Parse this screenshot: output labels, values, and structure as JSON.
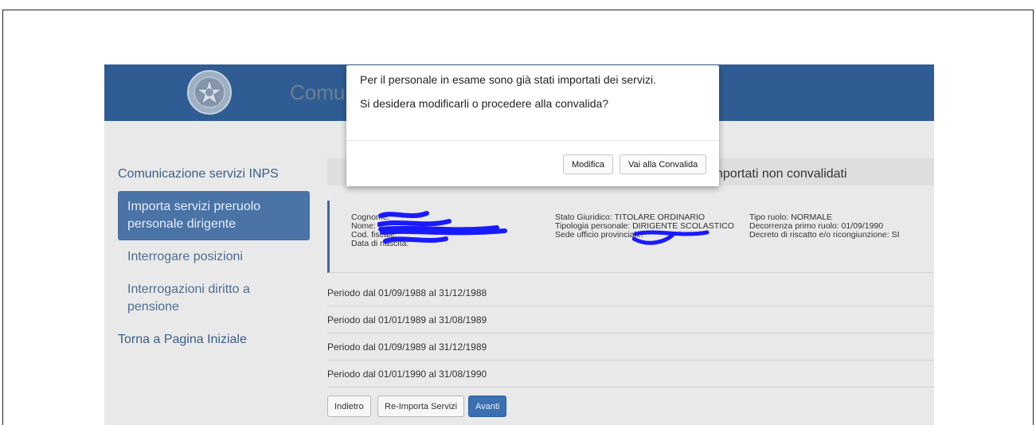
{
  "app": {
    "title": "Comunicazione servizi INPS"
  },
  "sidebar": {
    "title": "Comunicazione servizi INPS",
    "items": [
      {
        "label_line1": "Importa servizi preruolo",
        "label_line2": "personale dirigente",
        "active": true
      },
      {
        "label": "Interrogare posizioni"
      },
      {
        "label_line1": "Interrogazioni diritto a",
        "label_line2": "pensione"
      }
    ],
    "home": "Torna a Pagina Iniziale"
  },
  "section": {
    "title_visible": "nportati non convalidati"
  },
  "employee": {
    "col1": [
      "Cognome:",
      "Nome:",
      "Cod. fiscale:",
      "Data di nascita:"
    ],
    "col2": [
      "Stato Giuridico: TITOLARE ORDINARIO",
      "Tipologia personale: DIRIGENTE SCOLASTICO",
      "Sede ufficio provinciale:"
    ],
    "col3": [
      "Tipo ruolo: NORMALE",
      "Decorrenza primo ruolo: 01/09/1990",
      "Decreto di riscatto e/o ricongiunzione: SI"
    ]
  },
  "periods": [
    "Periodo dal 01/09/1988 al 31/12/1988",
    "Periodo dal 01/01/1989 al 31/08/1989",
    "Periodo dal 01/09/1989 al 31/12/1989",
    "Periodo dal 01/01/1990 al 31/08/1990"
  ],
  "buttons": {
    "back": "Indietro",
    "reimport": "Re-Importa Servizi",
    "next": "Avanti"
  },
  "modal": {
    "line1": "Per il personale in esame sono già stati importati dei servizi.",
    "line2": "Si desidera modificarli o procedere alla convalida?",
    "modify": "Modifica",
    "validate": "Vai alla Convalida"
  },
  "colors": {
    "header": "#2f5d93",
    "primary": "#3a70b1",
    "scribble": "#1a1aff"
  },
  "icons": {
    "emblem": "italian-republic-emblem"
  }
}
